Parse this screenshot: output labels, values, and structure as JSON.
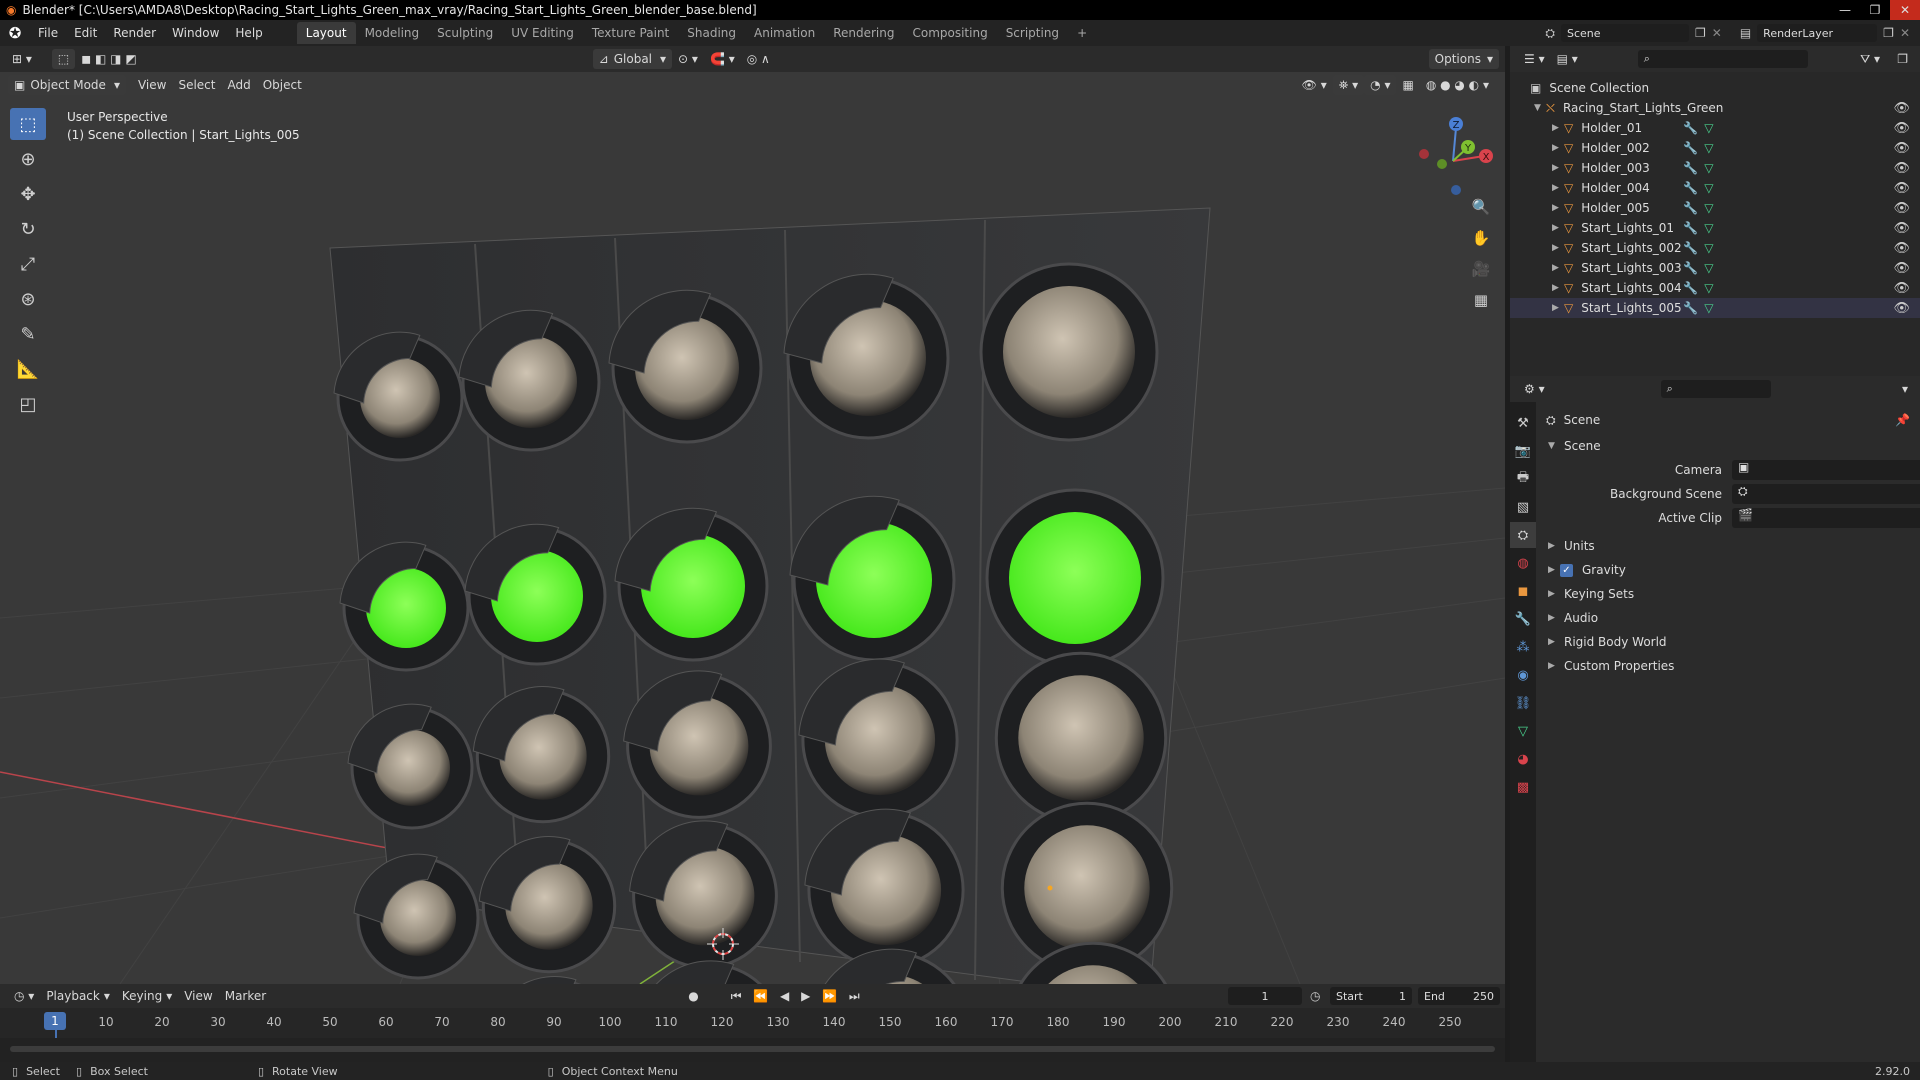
{
  "window": {
    "title": "Blender* [C:\\Users\\AMDA8\\Desktop\\Racing_Start_Lights_Green_max_vray/Racing_Start_Lights_Green_blender_base.blend]",
    "buttons": [
      "—",
      "❐",
      "✕"
    ]
  },
  "menu": [
    "File",
    "Edit",
    "Render",
    "Window",
    "Help"
  ],
  "workspaces": [
    {
      "label": "Layout",
      "active": true
    },
    {
      "label": "Modeling"
    },
    {
      "label": "Sculpting"
    },
    {
      "label": "UV Editing"
    },
    {
      "label": "Texture Paint"
    },
    {
      "label": "Shading"
    },
    {
      "label": "Animation"
    },
    {
      "label": "Rendering"
    },
    {
      "label": "Compositing"
    },
    {
      "label": "Scripting"
    }
  ],
  "scene_field": "Scene",
  "renderlayer_field": "RenderLayer",
  "viewport": {
    "transform_orientation": "Global",
    "options_label": "Options",
    "mode": "Object Mode",
    "menus": [
      "View",
      "Select",
      "Add",
      "Object"
    ],
    "info_line1": "User Perspective",
    "info_line2": "(1) Scene Collection | Start_Lights_005",
    "gizmo": {
      "z": "Z",
      "y": "Y",
      "x": "X"
    }
  },
  "outliner": {
    "root": "Scene Collection",
    "collection": "Racing_Start_Lights_Green",
    "items": [
      "Holder_01",
      "Holder_002",
      "Holder_003",
      "Holder_004",
      "Holder_005",
      "Start_Lights_01",
      "Start_Lights_002",
      "Start_Lights_003",
      "Start_Lights_004",
      "Start_Lights_005"
    ]
  },
  "properties": {
    "context": "Scene",
    "panel_title": "Scene",
    "fields": [
      {
        "label": "Camera"
      },
      {
        "label": "Background Scene"
      },
      {
        "label": "Active Clip"
      }
    ],
    "sections": [
      "Units",
      "Gravity",
      "Keying Sets",
      "Audio",
      "Rigid Body World",
      "Custom Properties"
    ]
  },
  "timeline": {
    "menus": [
      "Playback",
      "Keying",
      "View",
      "Marker"
    ],
    "current_frame": "1",
    "start_label": "Start",
    "start_value": "1",
    "end_label": "End",
    "end_value": "250",
    "ticks": [
      "10",
      "20",
      "30",
      "40",
      "50",
      "60",
      "70",
      "80",
      "90",
      "100",
      "110",
      "120",
      "130",
      "140",
      "150",
      "160",
      "170",
      "180",
      "190",
      "200",
      "210",
      "220",
      "230",
      "240",
      "250"
    ]
  },
  "status": {
    "select": "Select",
    "box_select": "Box Select",
    "rotate_view": "Rotate View",
    "context_menu": "Object Context Menu",
    "version": "2.92.0"
  },
  "colors": {
    "accent": "#4772b3",
    "light_on": "#6bff3a",
    "object": "#e9973f",
    "mesh": "#48d18d",
    "modifier": "#5f97d6",
    "x_axis": "#d9434c",
    "y_axis": "#7fc030"
  }
}
